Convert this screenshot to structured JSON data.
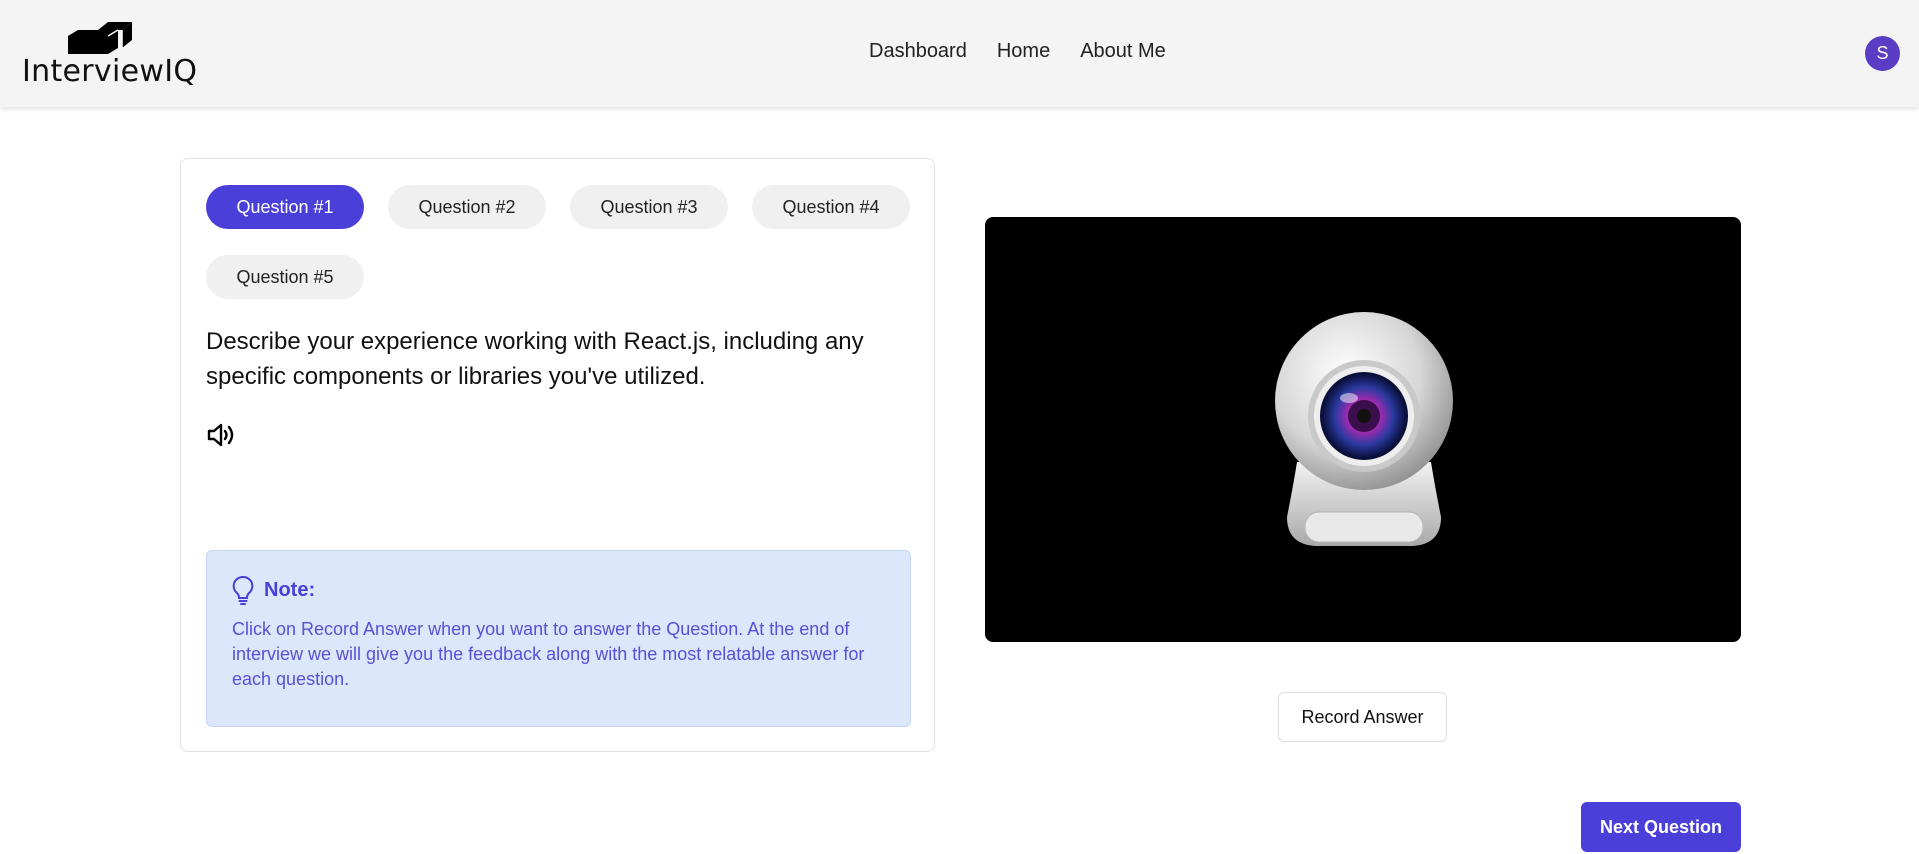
{
  "header": {
    "logo_text": "InterviewIQ",
    "nav": [
      "Dashboard",
      "Home",
      "About Me"
    ],
    "avatar_initial": "S"
  },
  "questions": {
    "tabs": [
      "Question #1",
      "Question #2",
      "Question #3",
      "Question #4",
      "Question #5"
    ],
    "active_index": 0,
    "text": "Describe your experience working with React.js, including any specific components or libraries you've utilized.",
    "speaker_icon": "speaker-icon"
  },
  "note": {
    "icon": "lightbulb-icon",
    "title": "Note:",
    "body": "Click on Record Answer when you want to answer the Question. At the end of interview we will give you the feedback along with the most relatable answer for each question."
  },
  "webcam": {
    "placeholder_icon": "webcam-icon"
  },
  "buttons": {
    "record": "Record Answer",
    "next": "Next Question"
  },
  "colors": {
    "accent": "#4a3fd8",
    "avatar": "#5b3cc4",
    "note_bg": "#dbe7fb",
    "header_bg": "#f4f4f4"
  }
}
